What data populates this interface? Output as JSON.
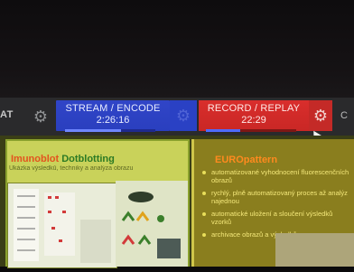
{
  "toolbar": {
    "left_partial_label": "AT",
    "stream": {
      "title": "STREAM / ENCODE",
      "time": "2:26:16",
      "progress": 0.62
    },
    "record": {
      "title": "RECORD / REPLAY",
      "time": "22:29",
      "progress": 0.38
    },
    "right_partial_label": "C",
    "colors": {
      "stream": "#2e43c4",
      "record": "#d42c2a",
      "toolbar": "#2a2a2c"
    }
  },
  "slide_left": {
    "title_word1": "Imunoblot",
    "title_word2": "Dotblotting",
    "subtitle": "Ukázka výsledků, techniky a analýza obrazu"
  },
  "slide_right": {
    "title": "EUROpattern",
    "bullets": [
      "automatizované vyhodnocení fluorescenčních obrazů",
      "rychlý, plně automatizovaný proces až analýz najednou",
      "automatické uložení a sloučení výsledků vzorků",
      "archivace obrazů a výsledků"
    ]
  },
  "icons": [
    "gear-icon",
    "cursor-icon"
  ]
}
